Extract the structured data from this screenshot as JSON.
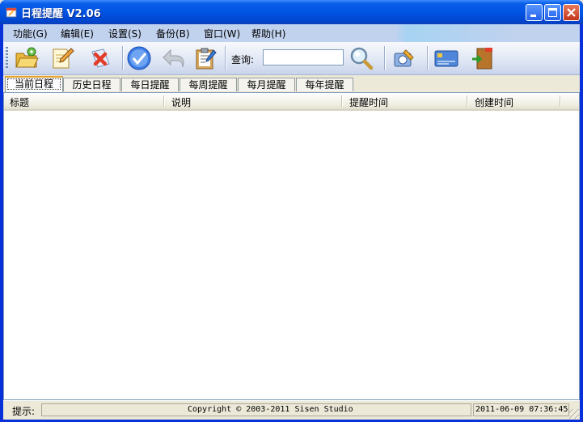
{
  "window": {
    "title": "日程提醒 V2.06"
  },
  "menu": [
    {
      "label": "功能(G)"
    },
    {
      "label": "编辑(E)"
    },
    {
      "label": "设置(S)"
    },
    {
      "label": "备份(B)"
    },
    {
      "label": "窗口(W)"
    },
    {
      "label": "帮助(H)"
    }
  ],
  "toolbar": {
    "search_label": "查询:",
    "search_value": "",
    "icons": [
      "open-folder-icon",
      "edit-note-icon",
      "delete-icon",
      "check-icon",
      "undo-icon",
      "clipboard-icon",
      "search-icon",
      "settings-tools-icon",
      "card-icon",
      "exit-door-icon"
    ]
  },
  "tabs": [
    {
      "label": "当前日程",
      "active": true
    },
    {
      "label": "历史日程"
    },
    {
      "label": "每日提醒"
    },
    {
      "label": "每周提醒"
    },
    {
      "label": "每月提醒"
    },
    {
      "label": "每年提醒"
    }
  ],
  "list": {
    "columns": [
      "标题",
      "说明",
      "提醒时间",
      "创建时间"
    ],
    "rows": []
  },
  "status": {
    "label": "提示:",
    "message": "",
    "copyright": "Copyright © 2003-2011 Sisen Studio",
    "datetime": "2011-06-09 07:36:45"
  },
  "colors": {
    "titlebar": "#0054e3",
    "menubar": "#c1d2ee",
    "active_tab_border": "#e6a12a"
  }
}
